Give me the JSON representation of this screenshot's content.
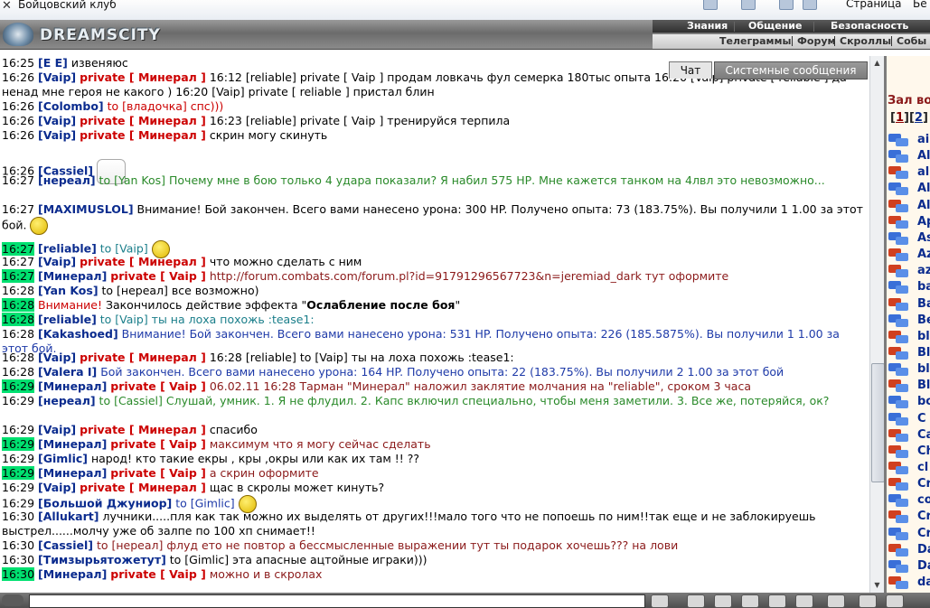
{
  "window": {
    "title": "Бойцовский клуб",
    "menu_page": "Страница",
    "menu_security": "Бе"
  },
  "header": {
    "logo_text": "DREAMSCITY",
    "nav_row1": [
      "Знания",
      "Общение",
      "Безопасность"
    ],
    "nav_row2": [
      "Телеграммы",
      "Форум",
      "Скроллы",
      "Собы"
    ]
  },
  "tabs": {
    "chat": "Чат",
    "system": "Системные сообщения"
  },
  "chat": {
    "lines": [
      {
        "time": "16:25",
        "parts": [
          [
            "nick",
            "[E E]"
          ],
          [
            "plain",
            " извеняюс"
          ]
        ]
      },
      {
        "time": "16:26",
        "parts": [
          [
            "nick",
            "[Vaip]"
          ],
          [
            "plain",
            " "
          ],
          [
            "priv",
            "private [ Минерал ]"
          ],
          [
            "plain",
            " 16:12 [reliable] private [ Vaip ] продам ловкачь фул семерка 180тыс опыта 16:20 [Vaip] private [ reliable ] да ненад мне героя не какого ) 16:20 [Vaip] private [ reliable ] пристал блин"
          ]
        ]
      },
      {
        "time": "16:26",
        "parts": [
          [
            "nick",
            "[Colombo]"
          ],
          [
            "red",
            " to [владочка] спс)))"
          ]
        ]
      },
      {
        "time": "16:26",
        "parts": [
          [
            "nick",
            "[Vaip]"
          ],
          [
            "plain",
            " "
          ],
          [
            "priv",
            "private [ Минерал ]"
          ],
          [
            "plain",
            " 16:23 [reliable] private [ Vaip ] тренируйся терпила"
          ]
        ]
      },
      {
        "time": "16:26",
        "parts": [
          [
            "nick",
            "[Vaip]"
          ],
          [
            "plain",
            " "
          ],
          [
            "priv",
            "private [ Минерал ]"
          ],
          [
            "plain",
            " скрин могу скинуть"
          ]
        ]
      },
      {
        "time": "16:26",
        "parts": [
          [
            "nick",
            "[Cassiel]"
          ]
        ],
        "smiley": "big"
      },
      {
        "time": "16:27",
        "parts": [
          [
            "nick",
            "[нереал]"
          ],
          [
            "green",
            " to [Yan Kos] Почему мне в бою только 4 удара показали? Я набил 575 НР. Мне кажется танком на 4лвл это невозможно..."
          ]
        ]
      },
      {
        "time": "16:27",
        "parts": [
          [
            "nick",
            "[MAXIMUSLOL]"
          ],
          [
            "plain",
            " Внимание! Бой закончен. Всего вами нанесено урона: 300 HP. Получено опыта: 73 (183.75%). Вы получили 1 1.00 за этот бой."
          ]
        ],
        "smiley": "small"
      },
      {
        "time": "16:27",
        "hl": true,
        "parts": [
          [
            "nick",
            "[reliable]"
          ],
          [
            "teal",
            " to [Vaip]"
          ]
        ],
        "smiley": "small"
      },
      {
        "time": "16:27",
        "parts": [
          [
            "nick",
            "[Vaip]"
          ],
          [
            "plain",
            " "
          ],
          [
            "priv",
            "private [ Минерал ]"
          ],
          [
            "plain",
            " что можно сделать с ним"
          ]
        ]
      },
      {
        "time": "16:27",
        "hl": true,
        "parts": [
          [
            "nick",
            "[Минерал]"
          ],
          [
            "plain",
            " "
          ],
          [
            "priv",
            "private [ Vaip ]"
          ],
          [
            "brown",
            " http://forum.combats.com/forum.pl?id=91791296567723&n=jeremiad_dark тут оформите"
          ]
        ]
      },
      {
        "time": "16:28",
        "parts": [
          [
            "nick",
            "[Yan Kos]"
          ],
          [
            "plain",
            " to [нереал] все возможно)"
          ]
        ]
      },
      {
        "time": "16:28",
        "hl": true,
        "parts": [
          [
            "red",
            "Внимание!"
          ],
          [
            "plain",
            " Закончилось действие эффекта \""
          ],
          [
            "bold",
            "Ослабление после боя"
          ],
          [
            "plain",
            "\""
          ]
        ]
      },
      {
        "time": "16:28",
        "hl": true,
        "parts": [
          [
            "nick",
            "[reliable]"
          ],
          [
            "teal",
            " to [Vaip] ты на лоха похожь :tease1:"
          ]
        ]
      },
      {
        "time": "16:28",
        "parts": [
          [
            "nick",
            "[Kakashoed]"
          ],
          [
            "blue",
            " Внимание! Бой закончен. Всего вами нанесено урона: 531 HP. Получено опыта: 226 (185.5875%). Вы получили 1 1.00 за этот бой."
          ]
        ]
      },
      {
        "time": "16:28",
        "parts": [
          [
            "nick",
            "[Vaip]"
          ],
          [
            "plain",
            " "
          ],
          [
            "priv",
            "private [ Минерал ]"
          ],
          [
            "plain",
            " 16:28 [reliable] to [Vaip] ты на лоха похожь :tease1:"
          ]
        ]
      },
      {
        "time": "16:28",
        "parts": [
          [
            "nick",
            "[Valera I]"
          ],
          [
            "blue",
            " Бой закончен. Всего вами нанесено урона: 164 HP. Получено опыта: 22 (183.75%). Вы получили 2 1.00 за этот бой"
          ]
        ]
      },
      {
        "time": "16:29",
        "hl": true,
        "parts": [
          [
            "nick",
            "[Минерал]"
          ],
          [
            "plain",
            " "
          ],
          [
            "priv",
            "private [ Vaip ]"
          ],
          [
            "brown",
            " 06.02.11 16:28 Тарман \"Минерал\" наложил заклятие молчания на \"reliable\", сроком 3 часа"
          ]
        ]
      },
      {
        "time": "16:29",
        "parts": [
          [
            "nick",
            "[нереал]"
          ],
          [
            "green",
            " to [Cassiel] Слушай, умник. 1. Я не флудил. 2. Капс включил специально, чтобы меня заметили. 3. Все же, потеряйся, ок?"
          ]
        ]
      },
      {
        "time": "16:29",
        "parts": [
          [
            "nick",
            "[Vaip]"
          ],
          [
            "plain",
            " "
          ],
          [
            "priv",
            "private [ Минерал ]"
          ],
          [
            "plain",
            " спасибо"
          ]
        ]
      },
      {
        "time": "16:29",
        "hl": true,
        "parts": [
          [
            "nick",
            "[Минерал]"
          ],
          [
            "plain",
            " "
          ],
          [
            "priv",
            "private [ Vaip ]"
          ],
          [
            "brown",
            " максимум что я могу сейчас сделать"
          ]
        ]
      },
      {
        "time": "16:29",
        "parts": [
          [
            "nick",
            "[Gimlic]"
          ],
          [
            "plain",
            " народ! кто такие екры , кры ,окры или как их там !! ??"
          ]
        ]
      },
      {
        "time": "16:29",
        "hl": true,
        "parts": [
          [
            "nick",
            "[Минерал]"
          ],
          [
            "plain",
            " "
          ],
          [
            "priv",
            "private [ Vaip ]"
          ],
          [
            "brown",
            " а скрин оформите"
          ]
        ]
      },
      {
        "time": "16:29",
        "parts": [
          [
            "nick",
            "[Vaip]"
          ],
          [
            "plain",
            " "
          ],
          [
            "priv",
            "private [ Минерал ]"
          ],
          [
            "plain",
            " щас в скролы может кинуть?"
          ]
        ]
      },
      {
        "time": "16:29",
        "parts": [
          [
            "nick",
            "[Большой Джуниор]"
          ],
          [
            "blue",
            " to [Gimlic]"
          ]
        ],
        "smiley": "small"
      },
      {
        "time": "16:30",
        "parts": [
          [
            "nick",
            "[Allukart]"
          ],
          [
            "plain",
            " лучники.....пля как так можно их выделять от других!!!мало того что не попоешь по ним!!так еще и не заблокируешь выстрел......молчу уже об залпе по 100 хп снимает!!"
          ]
        ]
      },
      {
        "time": "16:30",
        "parts": [
          [
            "nick",
            "[Cassiel]"
          ],
          [
            "brown",
            " to [нереал] флуд ето не повтор а бессмысленные выражении тут ты подарок хочешь??? на лови"
          ]
        ]
      },
      {
        "time": "16:30",
        "parts": [
          [
            "nick",
            "[Тимзырьятожетут]"
          ],
          [
            "plain",
            " to [Gimlic] эта апасные ацтойные играки)))"
          ]
        ]
      },
      {
        "time": "16:30",
        "hl": true,
        "parts": [
          [
            "nick",
            "[Минерал]"
          ],
          [
            "plain",
            " "
          ],
          [
            "priv",
            "private [ Vaip ]"
          ],
          [
            "brown",
            " можно и в скролах"
          ]
        ]
      }
    ]
  },
  "rightpanel": {
    "title": "Зал во",
    "page1": "1",
    "page2": "2",
    "users": [
      {
        "name": "ai",
        "c": "blue"
      },
      {
        "name": "Al",
        "c": "blue"
      },
      {
        "name": "al",
        "c": "red"
      },
      {
        "name": "Al",
        "c": "blue"
      },
      {
        "name": "Al",
        "c": "red"
      },
      {
        "name": "Ap",
        "c": "red"
      },
      {
        "name": "As",
        "c": "blue"
      },
      {
        "name": "Az",
        "c": "red"
      },
      {
        "name": "az",
        "c": "red"
      },
      {
        "name": "ba",
        "c": "blue"
      },
      {
        "name": "Ba",
        "c": "red"
      },
      {
        "name": "Be",
        "c": "blue"
      },
      {
        "name": "bl",
        "c": "red"
      },
      {
        "name": "Bl",
        "c": "red"
      },
      {
        "name": "bl",
        "c": "blue"
      },
      {
        "name": "Bl",
        "c": "red"
      },
      {
        "name": "bo",
        "c": "blue"
      },
      {
        "name": "C",
        "c": "blue"
      },
      {
        "name": "Ca",
        "c": "red"
      },
      {
        "name": "Ch",
        "c": "red"
      },
      {
        "name": "cl",
        "c": "red"
      },
      {
        "name": "Cr",
        "c": "red"
      },
      {
        "name": "co",
        "c": "blue"
      },
      {
        "name": "Cr",
        "c": "red"
      },
      {
        "name": "Cr",
        "c": "blue"
      },
      {
        "name": "Da",
        "c": "red"
      },
      {
        "name": "Da",
        "c": "blue"
      },
      {
        "name": "da",
        "c": "red"
      }
    ]
  },
  "icon_colors": {
    "blue": "#3a6fd8",
    "red": "#d04020"
  }
}
